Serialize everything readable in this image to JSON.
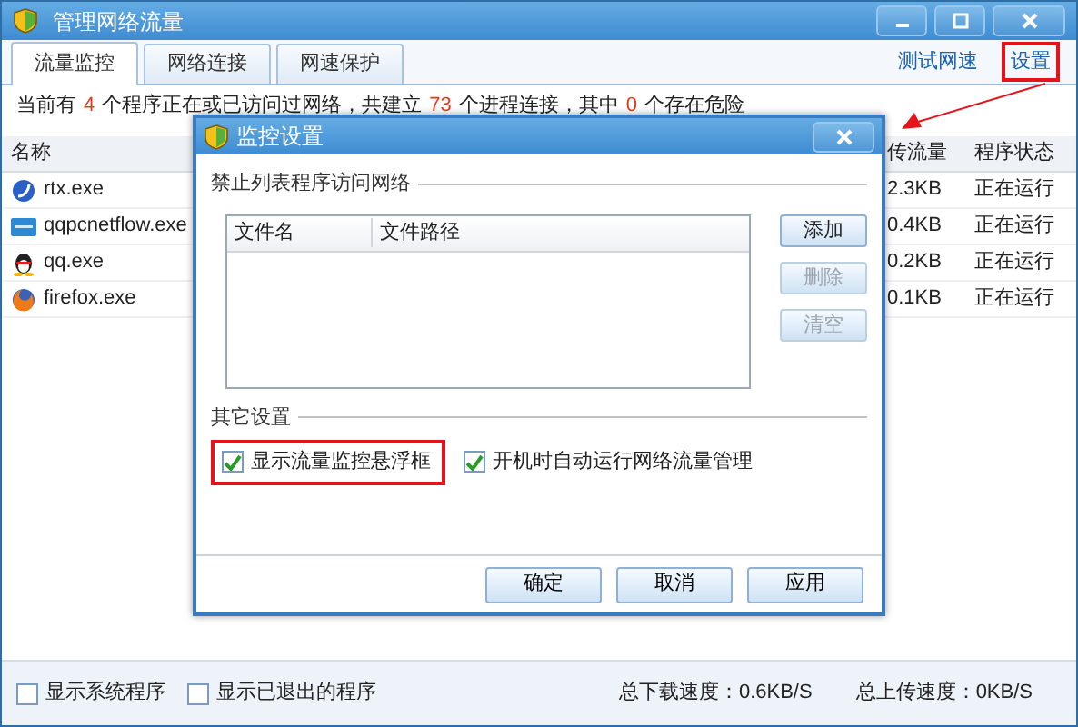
{
  "window": {
    "title": "管理网络流量"
  },
  "tabs": [
    {
      "label": "流量监控",
      "selected": true
    },
    {
      "label": "网络连接",
      "selected": false
    },
    {
      "label": "网速保护",
      "selected": false
    }
  ],
  "links": [
    {
      "label": "测试网速",
      "highlighted": false
    },
    {
      "label": "设置",
      "highlighted": true
    }
  ],
  "summary": [
    {
      "kind": "text",
      "text": "当前有"
    },
    {
      "kind": "count",
      "text": "4"
    },
    {
      "kind": "text",
      "text": "个程序正在或已访问过网络，共建立"
    },
    {
      "kind": "count",
      "text": "73"
    },
    {
      "kind": "text",
      "text": "个进程连接，其中"
    },
    {
      "kind": "count",
      "text": "0"
    },
    {
      "kind": "text",
      "text": "个存在危险"
    }
  ],
  "table": {
    "columns": [
      "名称",
      "传流量",
      "程序状态"
    ],
    "rows": [
      {
        "kind": "globe",
        "name": "rtx.exe",
        "column_2": "2.3KB",
        "column_3": "正在运行"
      },
      {
        "kind": "monitor",
        "name": "qqpcnetflow.exe",
        "column_2": "0.4KB",
        "column_3": "正在运行"
      },
      {
        "kind": "penguin",
        "name": "qq.exe",
        "column_2": "0.2KB",
        "column_3": "正在运行"
      },
      {
        "kind": "fox",
        "name": "firefox.exe",
        "column_2": "0.1KB",
        "column_3": "正在运行"
      }
    ]
  },
  "dialog": {
    "title": "监控设置",
    "blocklist": {
      "legend": "禁止列表程序访问网络",
      "columns": [
        "文件名",
        "文件路径"
      ],
      "buttons": [
        {
          "label": "添加",
          "disabled": false
        },
        {
          "label": "删除",
          "disabled": true
        },
        {
          "label": "清空",
          "disabled": true
        }
      ]
    },
    "other": {
      "legend": "其它设置",
      "options": [
        {
          "label": "显示流量监控悬浮框",
          "checked": true,
          "highlighted": true
        },
        {
          "label": "开机时自动运行网络流量管理",
          "checked": true,
          "highlighted": false
        }
      ]
    },
    "buttons": [
      "确定",
      "取消",
      "应用"
    ]
  },
  "status_bar": {
    "options": [
      {
        "label": "显示系统程序",
        "checked": false
      },
      {
        "label": "显示已退出的程序",
        "checked": false
      }
    ],
    "download": "总下载速度：0.6KB/S",
    "upload": "总上传速度：0KB/S"
  }
}
